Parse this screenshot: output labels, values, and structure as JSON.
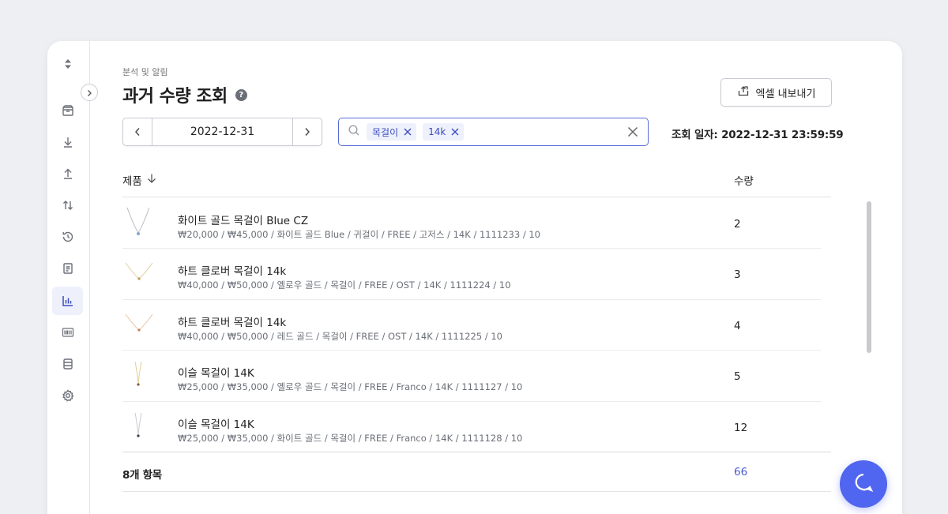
{
  "breadcrumb": "분석 및 알림",
  "page_title": "과거 수량 조회",
  "help_glyph": "?",
  "export_label": "엑셀 내보내기",
  "date_value": "2022-12-31",
  "search": {
    "chips": [
      {
        "label": "목걸이"
      },
      {
        "label": "14k"
      }
    ]
  },
  "query_date": "조회 일자: 2022-12-31 23:59:59",
  "table": {
    "col_product": "제품",
    "col_qty": "수량",
    "rows": [
      {
        "name": "화이트 골드 목걸이 Blue CZ",
        "meta": "₩20,000 / ₩45,000 / 화이트 골드 Blue / 귀걸이 / FREE / 고저스 / 14K / 1111233 / 10",
        "qty": "2"
      },
      {
        "name": "하트 클로버 목걸이 14k",
        "meta": "₩40,000 / ₩50,000 / 옐로우 골드 / 목걸이 / FREE / OST / 14K / 1111224 / 10",
        "qty": "3"
      },
      {
        "name": "하트 클로버 목걸이 14k",
        "meta": "₩40,000 / ₩50,000 / 레드 골드 / 목걸이 / FREE / OST / 14K / 1111225 / 10",
        "qty": "4"
      },
      {
        "name": "이슬 목걸이 14K",
        "meta": "₩25,000 / ₩35,000 / 옐로우 골드 / 목걸이 / FREE / Franco / 14K / 1111127 / 10",
        "qty": "5"
      },
      {
        "name": "이슬 목걸이 14K",
        "meta": "₩25,000 / ₩35,000 / 화이트 골드 / 목걸이 / FREE / Franco / 14K / 1111128 / 10",
        "qty": "12"
      }
    ]
  },
  "footer": {
    "count": "8개 항목",
    "total": "66"
  },
  "sidebar": {
    "items": [
      {
        "icon": "store-icon"
      },
      {
        "icon": "download-icon"
      },
      {
        "icon": "upload-icon"
      },
      {
        "icon": "transfer-icon"
      },
      {
        "icon": "history-icon"
      },
      {
        "icon": "document-icon"
      },
      {
        "icon": "bar-chart-icon",
        "active": true
      },
      {
        "icon": "barcode-icon"
      },
      {
        "icon": "database-icon"
      },
      {
        "icon": "gear-icon"
      }
    ]
  },
  "colors": {
    "accent": "#5065f0",
    "chip_bg": "#eef1fb",
    "chip_text": "#3b4cc0",
    "total_text": "#4a5bd0"
  }
}
